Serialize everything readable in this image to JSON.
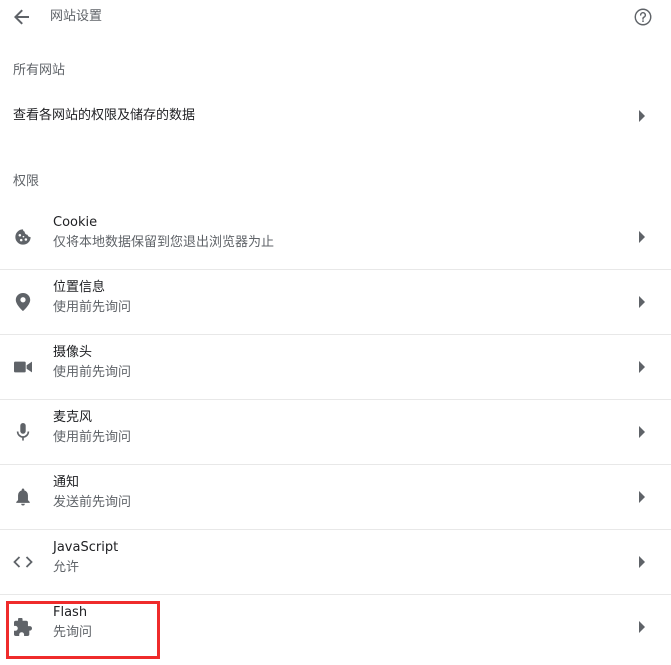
{
  "header": {
    "title": "网站设置",
    "back_icon": "arrow-back-icon",
    "help_icon": "help-icon"
  },
  "all_sites": {
    "section_label": "所有网站",
    "link_label": "查看各网站的权限及储存的数据"
  },
  "permissions": {
    "section_label": "权限",
    "items": [
      {
        "title": "Cookie",
        "subtitle": "仅将本地数据保留到您退出浏览器为止",
        "icon": "cookie-icon"
      },
      {
        "title": "位置信息",
        "subtitle": "使用前先询问",
        "icon": "location-icon"
      },
      {
        "title": "摄像头",
        "subtitle": "使用前先询问",
        "icon": "camera-icon"
      },
      {
        "title": "麦克风",
        "subtitle": "使用前先询问",
        "icon": "microphone-icon"
      },
      {
        "title": "通知",
        "subtitle": "发送前先询问",
        "icon": "bell-icon"
      },
      {
        "title": "JavaScript",
        "subtitle": "允许",
        "icon": "code-icon"
      },
      {
        "title": "Flash",
        "subtitle": "先询问",
        "icon": "puzzle-icon"
      }
    ]
  },
  "colors": {
    "highlight": "#ef2b2b",
    "icon_gray": "#5f6368",
    "text_primary": "#202124"
  }
}
